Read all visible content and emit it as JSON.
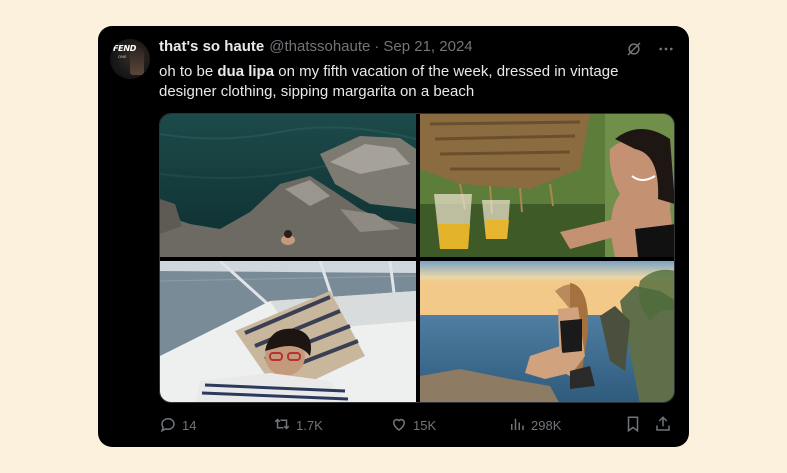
{
  "tweet": {
    "avatar": {
      "text": "FEND",
      "sub": "ONE"
    },
    "display_name": "that's so haute",
    "handle": "@thatssohaute",
    "separator": "·",
    "date": "Sep 21, 2024",
    "text_part1": "oh to be ",
    "text_bold": "dua lipa",
    "text_part2": " on my fifth vacation of the week, dressed in vintage designer clothing, sipping margarita on a beach",
    "media": [
      {
        "icon": "photo-rocky-sea-icon"
      },
      {
        "icon": "photo-toast-drinks-icon"
      },
      {
        "icon": "photo-boat-deck-icon"
      },
      {
        "icon": "photo-sunset-cliff-icon"
      }
    ],
    "actions": {
      "replies": "14",
      "reposts": "1.7K",
      "likes": "15K",
      "views": "298K"
    }
  },
  "colors": {
    "page_background": "#fbf1dc",
    "card_background": "#000000",
    "text_primary": "#e7e9ea",
    "text_secondary": "#71767b"
  },
  "icons": {
    "grok": "grok-icon",
    "more": "more-horizontal-icon",
    "reply": "reply-icon",
    "repost": "repost-icon",
    "like": "heart-icon",
    "views": "views-chart-icon",
    "bookmark": "bookmark-icon",
    "share": "share-icon"
  }
}
